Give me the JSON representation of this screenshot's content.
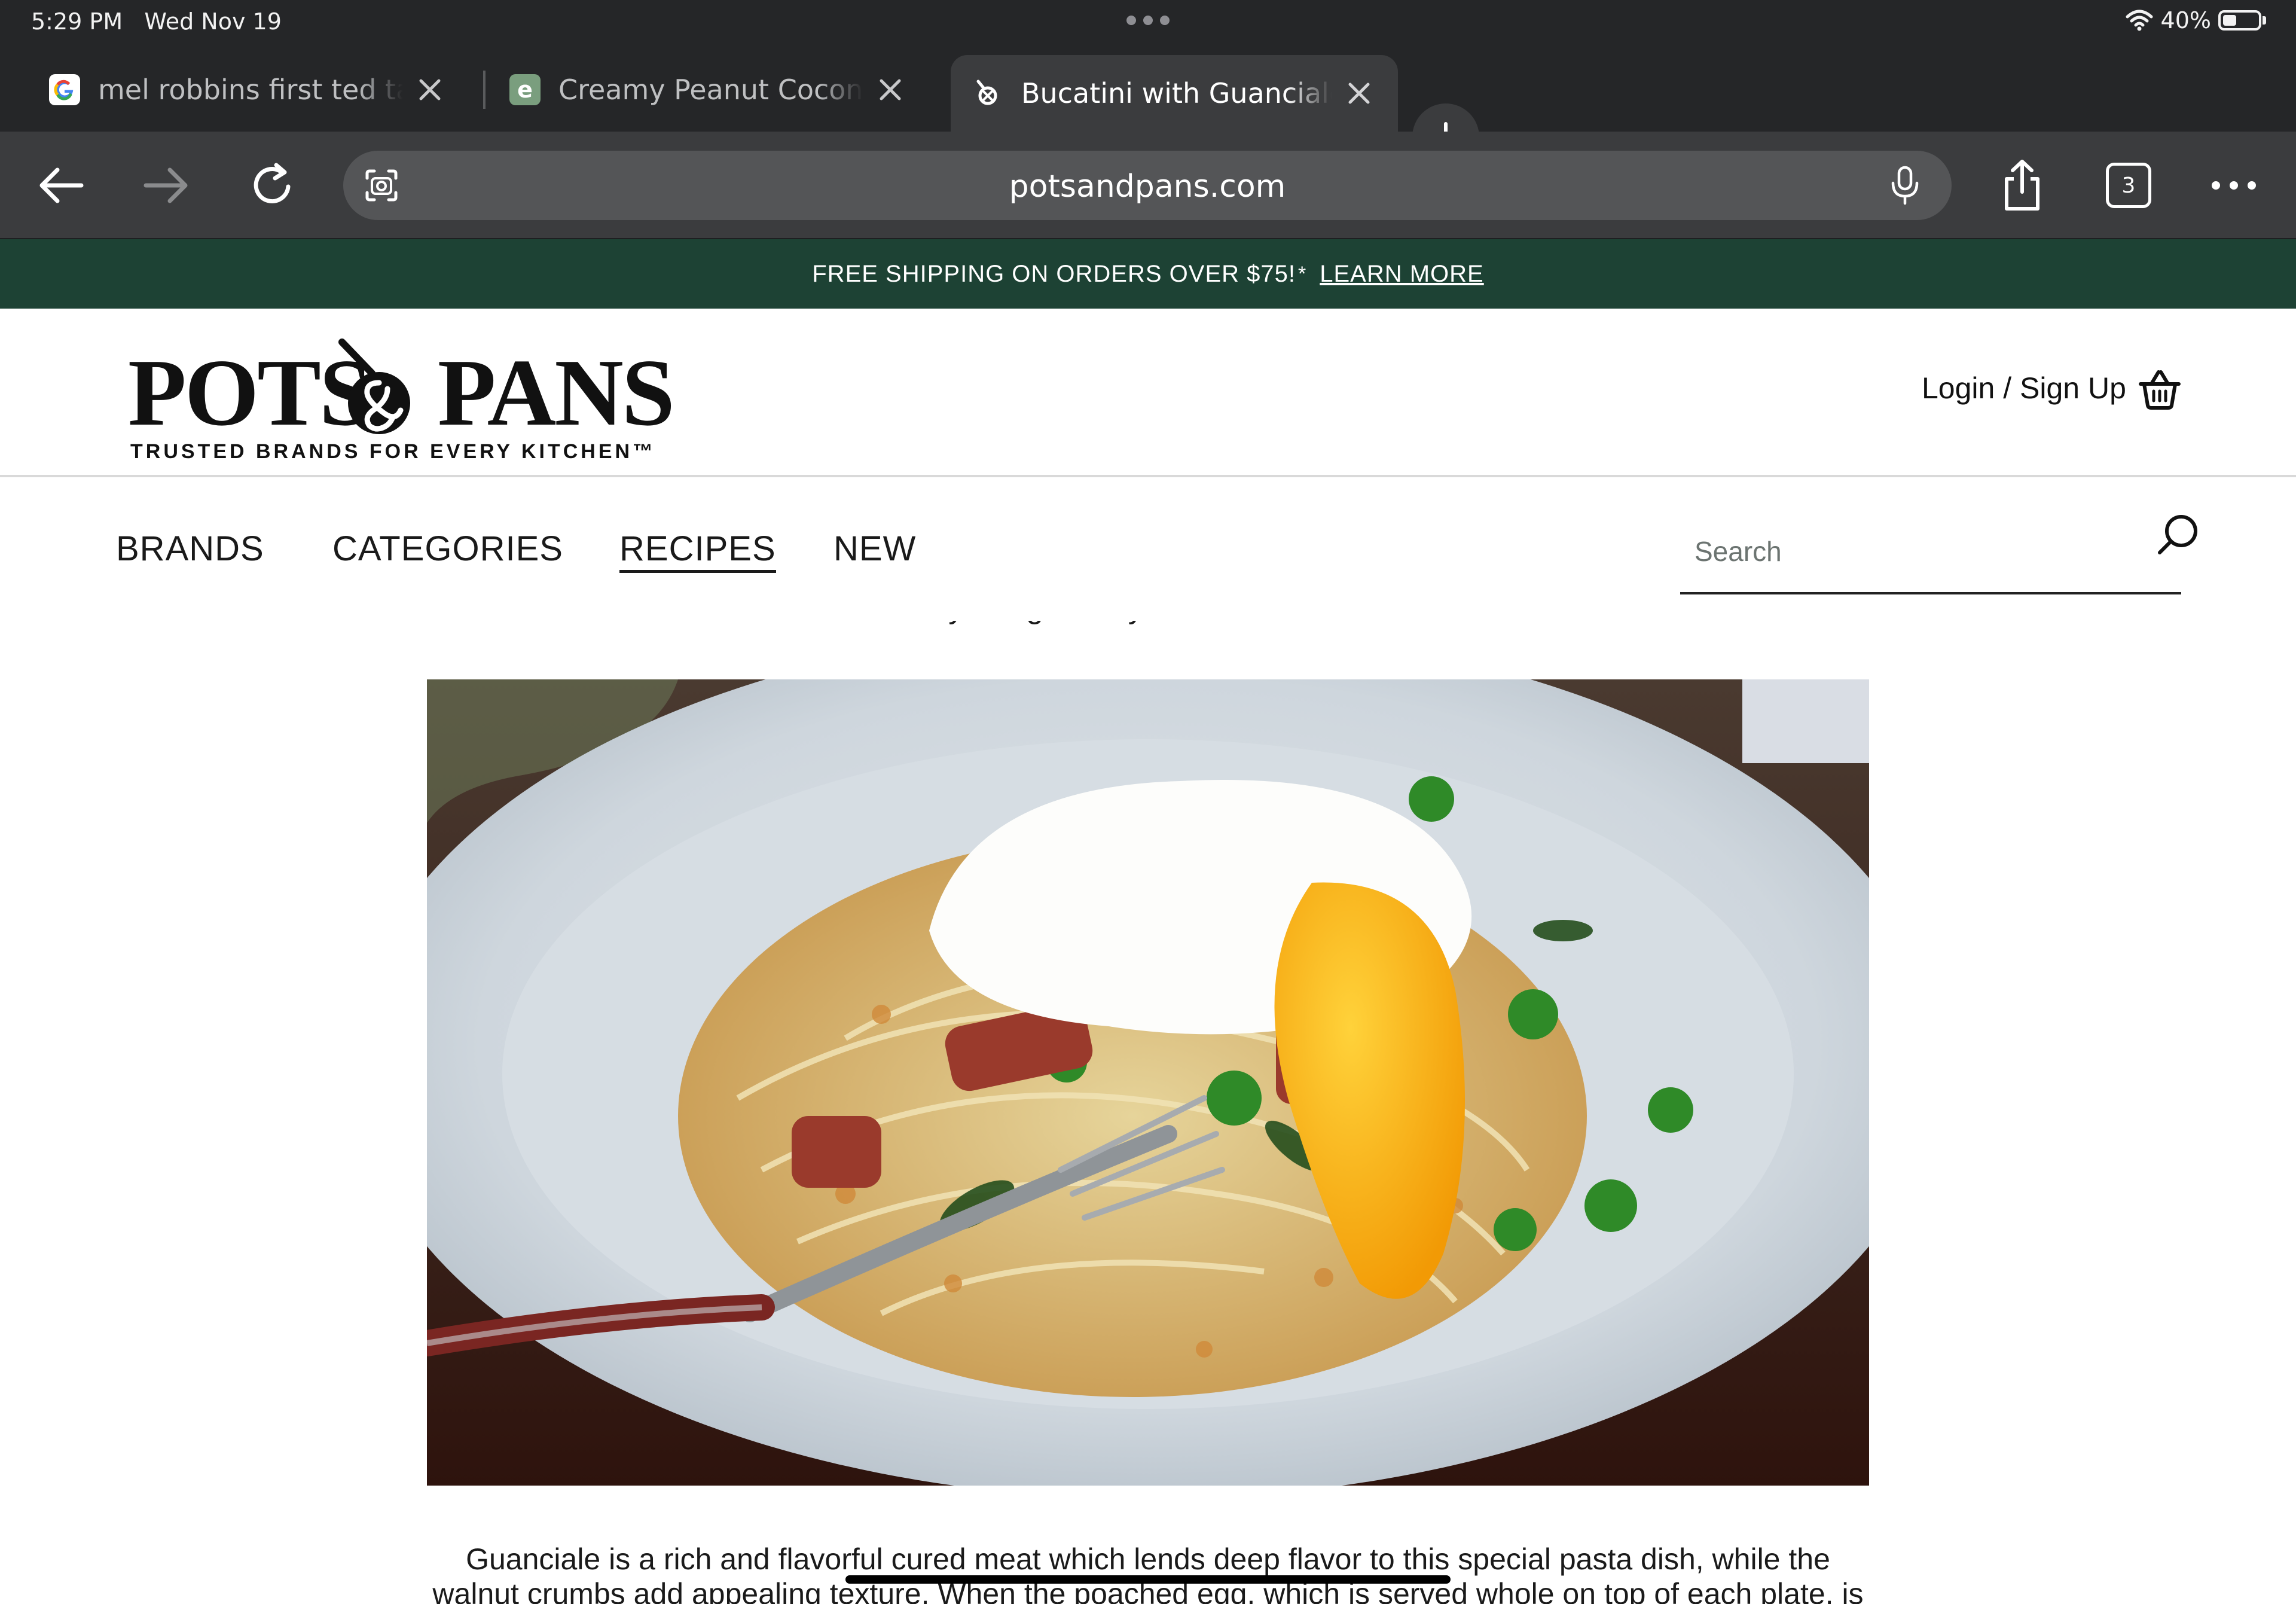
{
  "status_bar": {
    "time": "5:29 PM",
    "date": "Wed Nov 19",
    "battery": "40%",
    "battery_level": 0.4
  },
  "tabs": [
    {
      "title": "mel robbins first ted talk",
      "favicon": "google-favicon",
      "active": false
    },
    {
      "title": "Creamy Peanut Coconut",
      "favicon": "e-favicon",
      "active": false
    },
    {
      "title": "Bucatini with Guanciale,",
      "favicon": "potsandpans-favicon",
      "active": true
    }
  ],
  "toolbar": {
    "url": "potsandpans.com",
    "tab_count": "3"
  },
  "promo": {
    "text": "FREE SHIPPING ON ORDERS OVER $75!",
    "asterisk": "*",
    "link": "LEARN MORE"
  },
  "header": {
    "logo_left": "POTS",
    "logo_right": "PANS",
    "logo_tagline": "TRUSTED BRANDS FOR EVERY KITCHEN™",
    "login": "Login / Sign Up"
  },
  "nav": {
    "items": [
      "BRANDS",
      "CATEGORIES",
      "RECIPES",
      "NEW"
    ],
    "active": "RECIPES",
    "search_placeholder": "Search"
  },
  "article": {
    "byline": "By Marge Perry & David Bonom",
    "intro_line1": "Guanciale is a rich and flavorful cured meat which lends deep flavor to this special pasta dish, while the",
    "intro_line2": "walnut crumbs add appealing texture. When the poached egg, which is served whole on top of each plate, is"
  }
}
